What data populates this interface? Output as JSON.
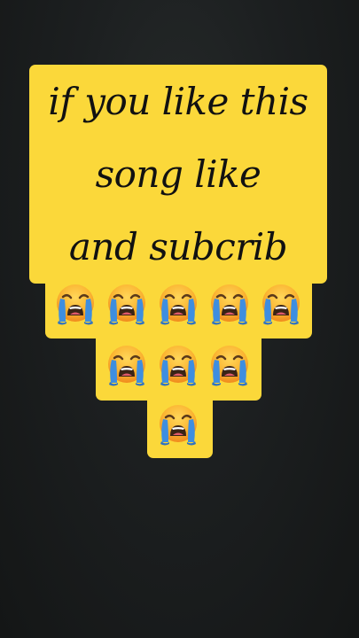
{
  "caption": {
    "line1": "if you like this",
    "line2": "song like",
    "line3": "and subcrib"
  },
  "emoji": {
    "icon": "loudly-crying-face-icon",
    "rows": [
      5,
      3,
      1
    ]
  },
  "colors": {
    "background": "#1c1f20",
    "card": "#fbd83a",
    "text": "#111111",
    "emoji_face": "#f9a825",
    "tears": "#3e8ee0"
  }
}
